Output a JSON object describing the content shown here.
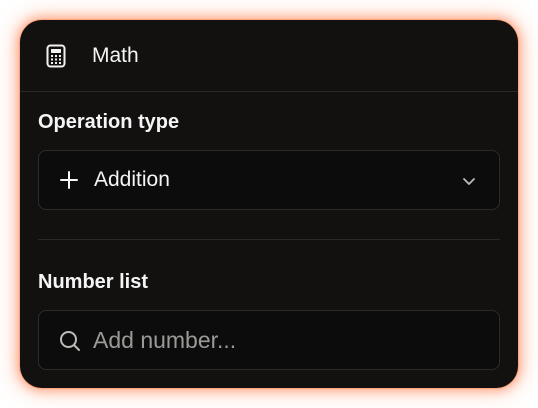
{
  "header": {
    "icon": "calculator-icon",
    "title": "Math"
  },
  "operation": {
    "label": "Operation type",
    "icon": "plus-icon",
    "selected": "Addition",
    "chevron": "chevron-down-icon"
  },
  "numbers": {
    "label": "Number list",
    "icon": "search-icon",
    "placeholder": "Add number..."
  },
  "colors": {
    "panel_bg": "#121110",
    "field_bg": "#0c0c0c",
    "glow": "#ff7846",
    "text": "#f5f5f5",
    "placeholder": "#9c9a97"
  }
}
